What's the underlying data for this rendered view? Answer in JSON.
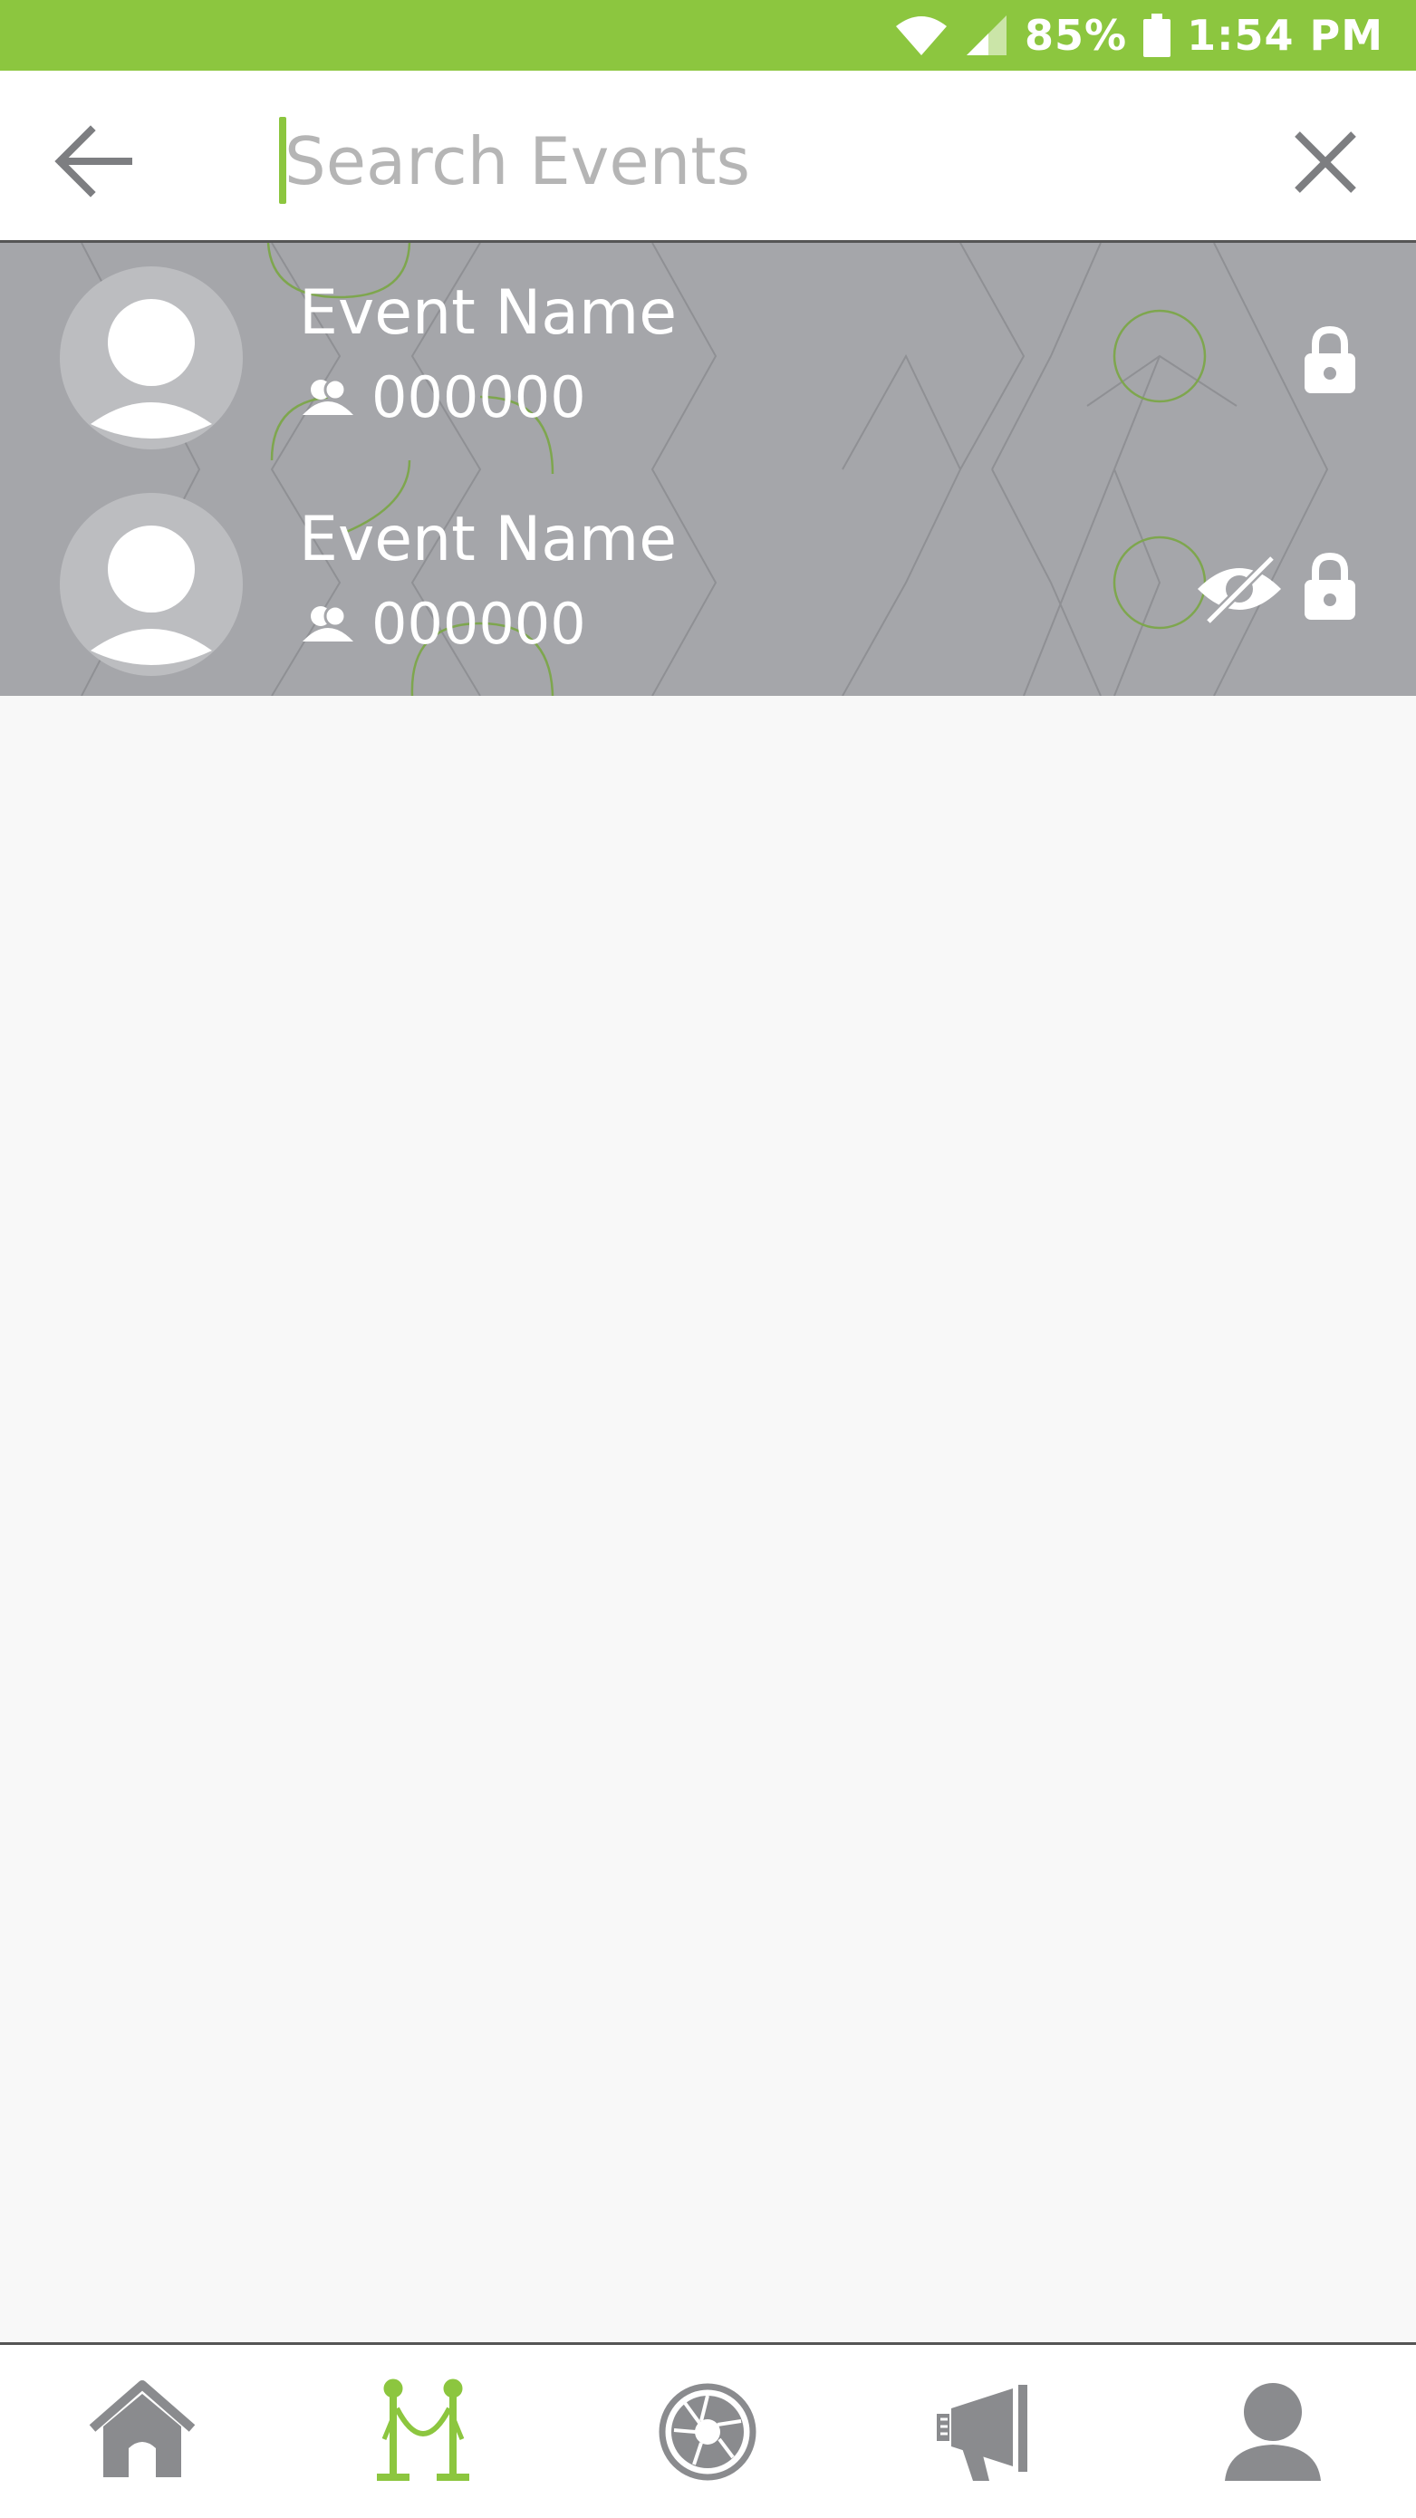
{
  "status_bar": {
    "battery": "85%",
    "time": "1:54 PM",
    "icons": [
      "wifi-icon",
      "cell-signal-icon",
      "battery-icon"
    ]
  },
  "search": {
    "placeholder": "Search Events",
    "value": "",
    "back_icon": "arrow-left-icon",
    "clear_icon": "close-icon"
  },
  "events": [
    {
      "name": "Event Name",
      "count": "000000",
      "hidden": false,
      "locked": true
    },
    {
      "name": "Event Name",
      "count": "000000",
      "hidden": true,
      "locked": true
    }
  ],
  "bottom_nav": {
    "items": [
      {
        "icon": "home-icon",
        "active": false
      },
      {
        "icon": "events-stanchion-icon",
        "active": true
      },
      {
        "icon": "camera-aperture-icon",
        "active": false
      },
      {
        "icon": "megaphone-icon",
        "active": false
      },
      {
        "icon": "profile-icon",
        "active": false
      }
    ]
  },
  "colors": {
    "accent": "#8cc63f",
    "list_background": "#a5a6aa",
    "icon_gray": "#8a8b8e",
    "screen_background": "#f8f8f8"
  }
}
